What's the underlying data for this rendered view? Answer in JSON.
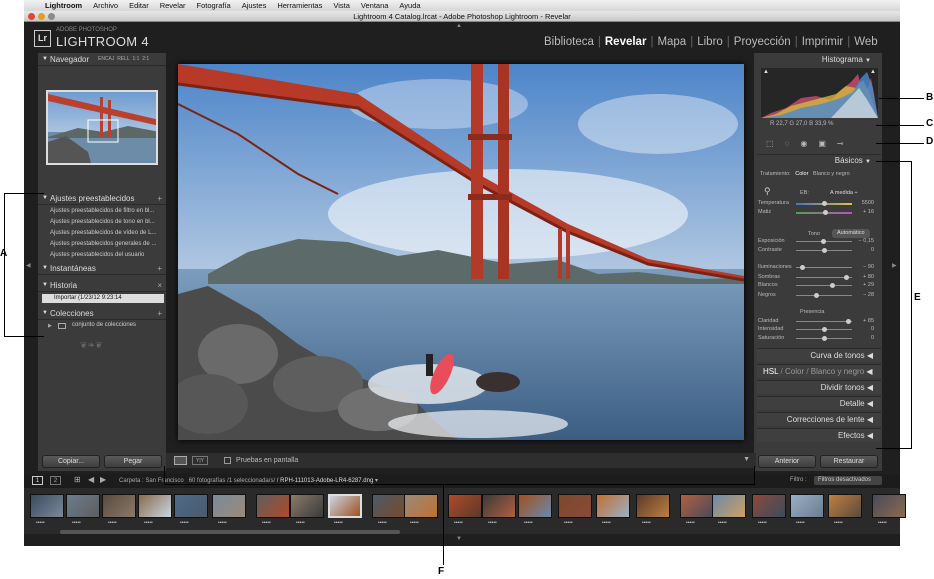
{
  "menubar": {
    "app": "Lightroom",
    "items": [
      "Archivo",
      "Editar",
      "Revelar",
      "Fotografía",
      "Ajustes",
      "Herramientas",
      "Vista",
      "Ventana",
      "Ayuda"
    ]
  },
  "window": {
    "title": "Lightroom 4 Catalog.lrcat - Adobe Photoshop Lightroom - Revelar"
  },
  "identity": {
    "logo": "Lr",
    "line1": "ADOBE PHOTOSHOP",
    "line2": "LIGHTROOM 4"
  },
  "modules": {
    "items": [
      "Biblioteca",
      "Revelar",
      "Mapa",
      "Libro",
      "Proyección",
      "Imprimir",
      "Web"
    ],
    "active": "Revelar"
  },
  "left_panel": {
    "navigator": {
      "title": "Navegador",
      "zoom": [
        "ENCAJ",
        "RELL",
        "1:1",
        "2:1"
      ]
    },
    "presets": {
      "title": "Ajustes preestablecidos",
      "items": [
        "Ajustes preestablecidos de filtro en bl...",
        "Ajustes preestablecidos de tono en bl...",
        "Ajustes preestablecidos de vídeo de L...",
        "Ajustes preestablecidos generales de ...",
        "Ajustes preestablecidos del usuario"
      ]
    },
    "snapshots": {
      "title": "Instantáneas"
    },
    "history": {
      "title": "Historia",
      "item": "Importar (1/23/12 9:23:14"
    },
    "collections": {
      "title": "Colecciones",
      "item": "conjunto de colecciones"
    },
    "buttons": {
      "copy": "Copiar...",
      "paste": "Pegar"
    }
  },
  "right_panel": {
    "histogram": {
      "title": "Histograma",
      "r_label": "R",
      "r": "22,7",
      "g_label": "G",
      "g": "27,0",
      "b_label": "B",
      "b": "33,9",
      "pct": "%"
    },
    "basics": {
      "title": "Básicos",
      "treatment_label": "Tratamiento:",
      "color": "Color",
      "bw": "Blanco y negro",
      "wb_label": "EB:",
      "wb_value": "A medida ÷",
      "tone_label": "Tono",
      "auto": "Automático",
      "presence_label": "Presencia",
      "sliders": [
        {
          "label": "Temperatura",
          "value": "5500",
          "pos": 0.5
        },
        {
          "label": "Matiz",
          "value": "+ 16",
          "pos": 0.52
        },
        {
          "label": "Exposición",
          "value": "− 0,15",
          "pos": 0.48
        },
        {
          "label": "Contraste",
          "value": "0",
          "pos": 0.5
        },
        {
          "label": "Iluminaciones",
          "value": "− 90",
          "pos": 0.1
        },
        {
          "label": "Sombras",
          "value": "+ 80",
          "pos": 0.9
        },
        {
          "label": "Blancos",
          "value": "+ 29",
          "pos": 0.65
        },
        {
          "label": "Negros",
          "value": "− 28",
          "pos": 0.36
        },
        {
          "label": "Claridad",
          "value": "+ 85",
          "pos": 0.92
        },
        {
          "label": "Intensidad",
          "value": "0",
          "pos": 0.5
        },
        {
          "label": "Saturación",
          "value": "0",
          "pos": 0.5
        }
      ]
    },
    "sections": [
      "Curva de tonos",
      "HSL / Color / Blanco y negro",
      "Dividir tonos",
      "Detalle",
      "Correcciones de lente",
      "Efectos"
    ],
    "hsl": {
      "hsl": "HSL",
      "color": "Color",
      "bw": "Blanco y negro"
    },
    "buttons": {
      "previous": "Anterior",
      "reset": "Restaurar"
    }
  },
  "toolbar": {
    "proof": "Pruebas en pantalla"
  },
  "filmstrip_bar": {
    "screen1": "1",
    "screen2": "2",
    "folder": "Carpeta : San Francisco",
    "count": "60 fotografías /1 seleccionada/s/",
    "file": "/ RPH-111013-Adobe-LR4-6287.dng",
    "filter_label": "Filtro :",
    "filter_value": "Filtros desactivados"
  },
  "callouts": [
    "A",
    "B",
    "C",
    "D",
    "E",
    "F"
  ]
}
